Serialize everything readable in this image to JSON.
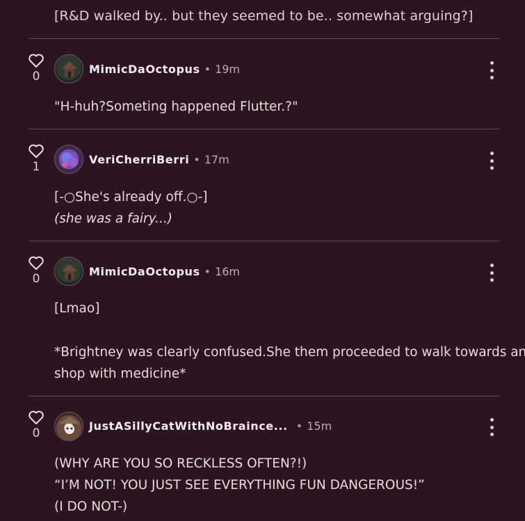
{
  "top_text": "[R&D walked by.. but they seemed to be.. somewhat arguing?]",
  "comments": [
    {
      "username": "MimicDaOctopus",
      "time": "19m",
      "likes": "0",
      "lines": [
        "\"H-huh?Someting happened Flutter.?\""
      ]
    },
    {
      "username": "VeriCherriBerri",
      "time": "17m",
      "likes": "1",
      "lines": [
        "[-○She's already off.○-]",
        "(she was a fairy...)"
      ]
    },
    {
      "username": "MimicDaOctopus",
      "time": "16m",
      "likes": "0",
      "lines": [
        "[Lmao]",
        "*Brightney was clearly confused.She them proceeded to walk towards any",
        "shop with medicine*"
      ]
    },
    {
      "username": "JustASillyCatWithNoBraince...",
      "time": "15m",
      "likes": "0",
      "lines": [
        "(WHY ARE YOU SO RECKLESS OFTEN?!)",
        "“I’M NOT! YOU JUST SEE EVERYTHING FUN DANGEROUS!”",
        "(I DO NOT-)"
      ]
    }
  ],
  "icons": {
    "like": "heart-outline-icon",
    "more": "vertical-ellipsis-icon"
  },
  "colors": {
    "background": "#2c1520",
    "divider": "#5d4c54",
    "text": "#e4dde0"
  }
}
